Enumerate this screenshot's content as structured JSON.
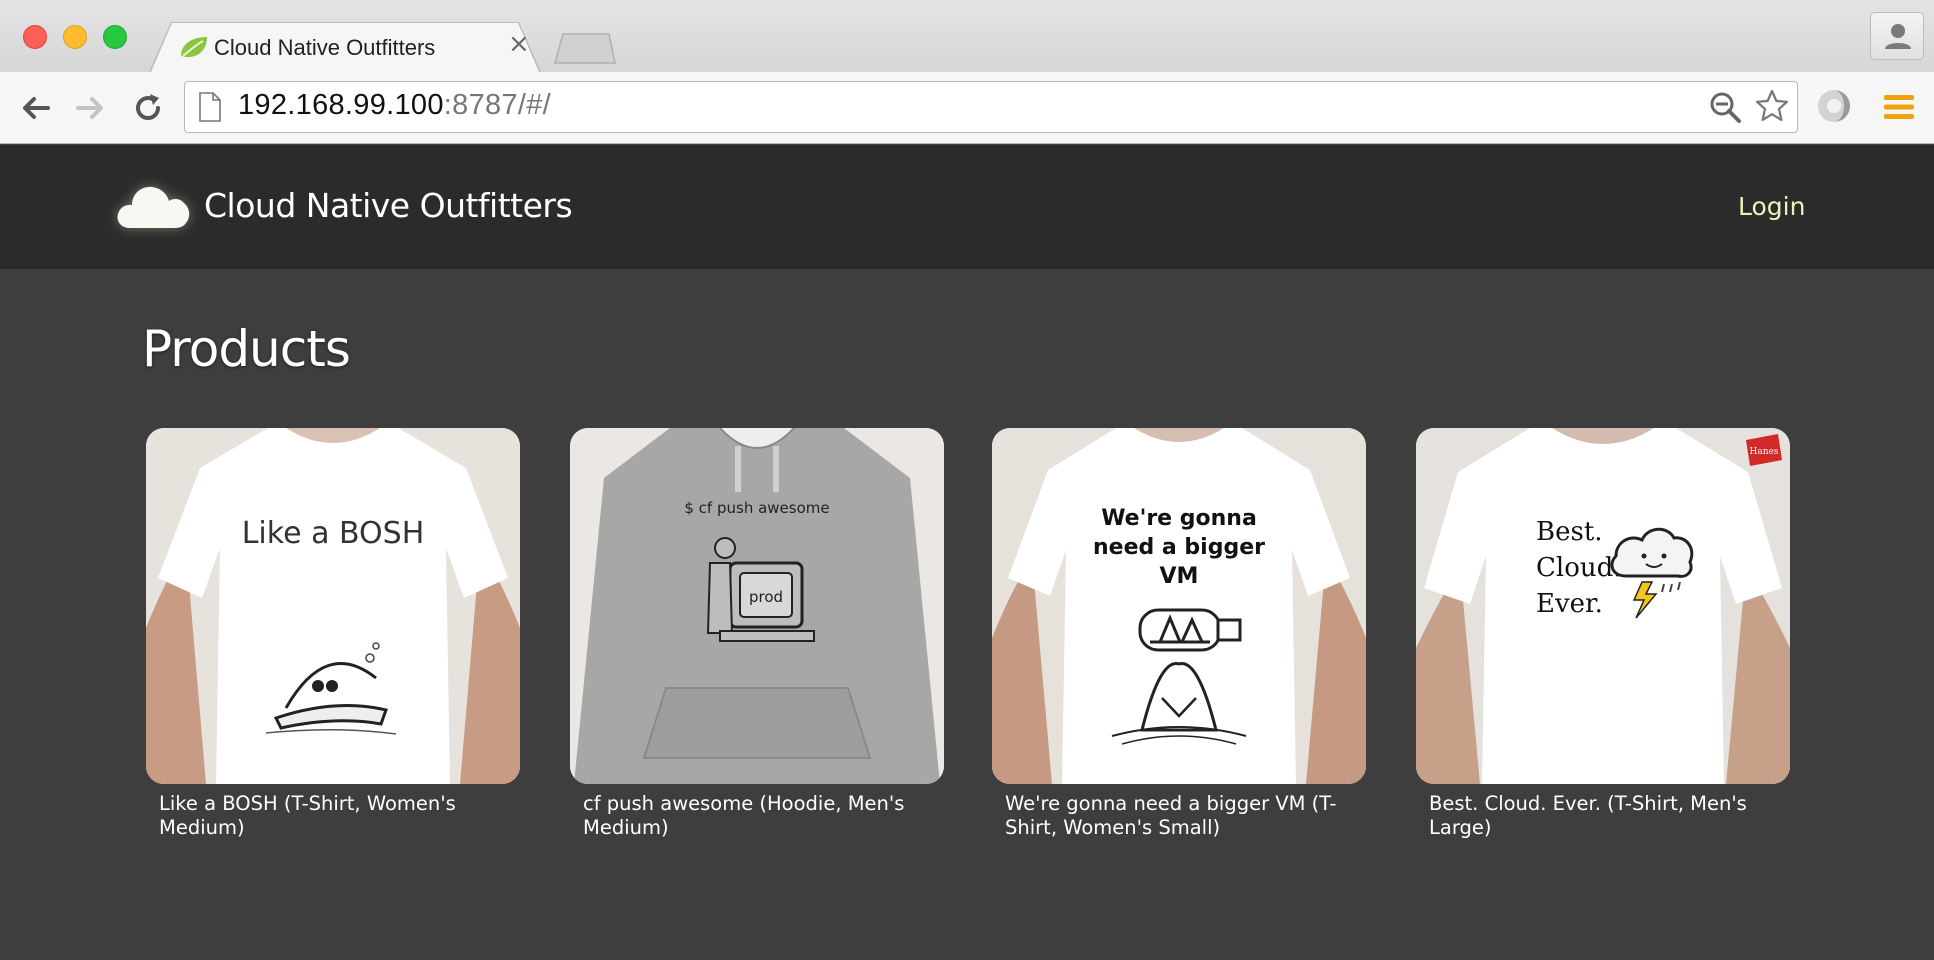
{
  "browser": {
    "tab_title": "Cloud Native Outfitters",
    "tab_close": "×",
    "url_host": "192.168.99.100",
    "url_rest": ":8787/#/"
  },
  "header": {
    "brand": "Cloud Native Outfitters",
    "login": "Login"
  },
  "main": {
    "title": "Products",
    "products": [
      {
        "label": "Like a BOSH (T-Shirt, Women's Medium)",
        "garment": "t-shirt",
        "shirt_color": "#ffffff",
        "print_text": [
          "Like a BOSH"
        ]
      },
      {
        "label": "cf push awesome (Hoodie, Men's Medium)",
        "garment": "hoodie",
        "shirt_color": "#a9a9a9",
        "print_text": [
          "$ cf push awesome",
          "prod"
        ]
      },
      {
        "label": "We're gonna need a bigger VM (T-Shirt, Women's Small)",
        "garment": "t-shirt",
        "shirt_color": "#ffffff",
        "print_text": [
          "We're gonna",
          "need a bigger",
          "VM"
        ]
      },
      {
        "label": "Best. Cloud. Ever. (T-Shirt, Men's Large)",
        "garment": "t-shirt",
        "shirt_color": "#ffffff",
        "print_text": [
          "Best.",
          "Cloud.",
          "Ever.",
          "Hanes"
        ]
      }
    ]
  },
  "colors": {
    "page_bg": "#3e3e3e",
    "header_bg": "#2b2b2b",
    "login_link": "#eef0b8"
  }
}
